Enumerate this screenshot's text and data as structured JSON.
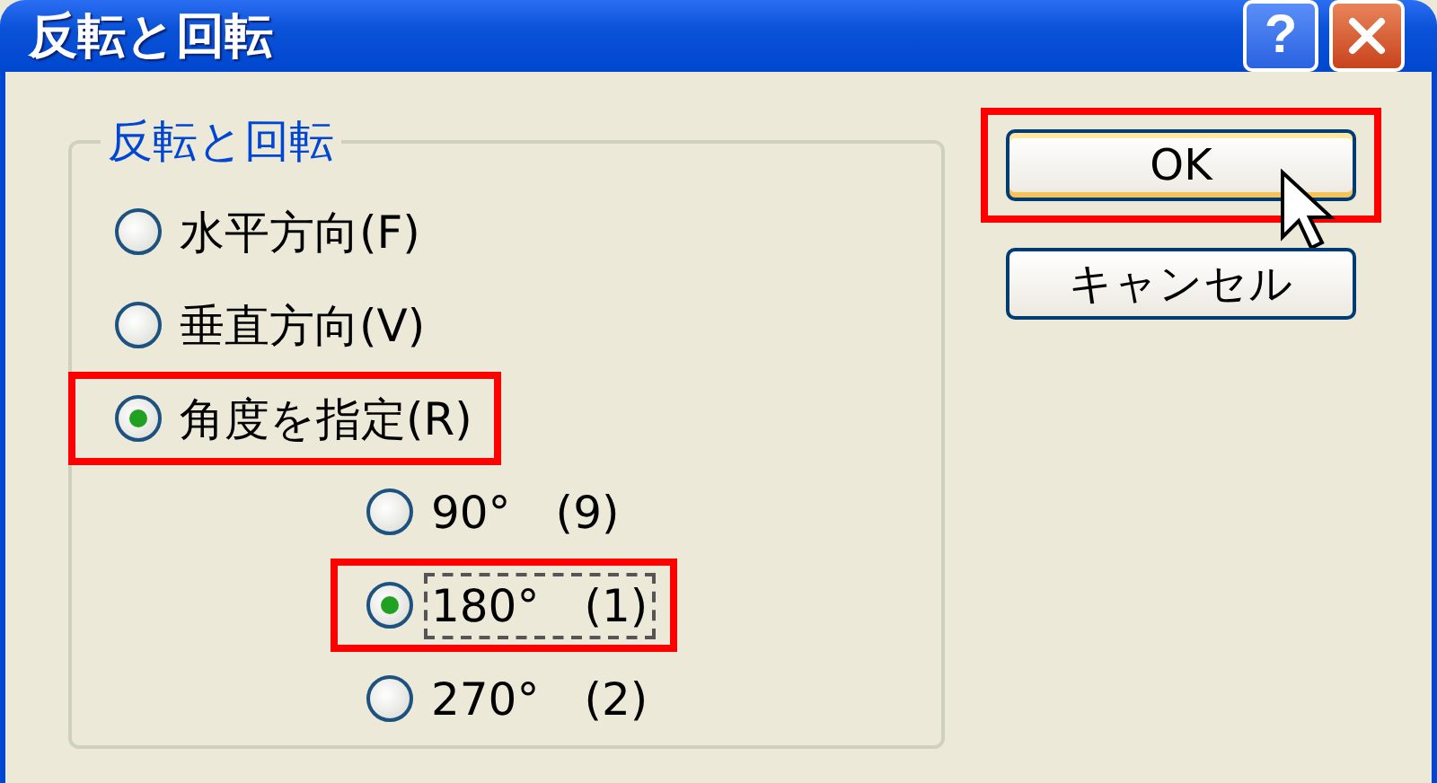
{
  "window": {
    "title": "反転と回転",
    "help_button": "?"
  },
  "group": {
    "title": "反転と回転",
    "options": [
      {
        "label": "水平方向(F)",
        "selected": false,
        "highlighted": false
      },
      {
        "label": "垂直方向(V)",
        "selected": false,
        "highlighted": false
      },
      {
        "label": "角度を指定(R)",
        "selected": true,
        "highlighted": true,
        "children": [
          {
            "label": "90°　(9)",
            "selected": false,
            "highlighted": false,
            "focused": false
          },
          {
            "label": "180°　(1)",
            "selected": true,
            "highlighted": true,
            "focused": true
          },
          {
            "label": "270°　(2)",
            "selected": false,
            "highlighted": false,
            "focused": false
          }
        ]
      }
    ]
  },
  "buttons": [
    {
      "label": "OK",
      "default": true,
      "highlighted": true
    },
    {
      "label": "キャンセル",
      "default": false,
      "highlighted": false
    }
  ]
}
